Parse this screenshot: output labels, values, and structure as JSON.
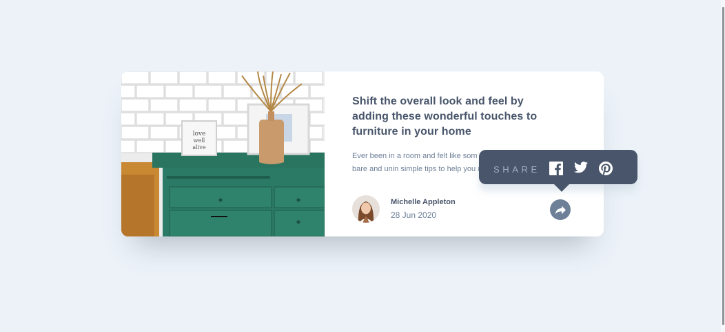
{
  "article": {
    "title": "Shift the overall look and feel by adding these wonderful touches to furniture in your home",
    "description_visible": "Ever been in a room and felt like som Perhaps it felt slightly bare and unin simple tips to help you make any roo"
  },
  "author": {
    "name": "Michelle Appleton",
    "date": "28 Jun 2020"
  },
  "share": {
    "label": "SHARE",
    "icons": [
      "facebook-icon",
      "twitter-icon",
      "pinterest-icon"
    ],
    "button_icon": "share-icon"
  },
  "colors": {
    "page_background": "#ecf2f8",
    "card_background": "#ffffff",
    "dark_blue": "#48556a",
    "grayish_blue": "#6e8098",
    "light_grayish_blue": "#9eafc2"
  }
}
